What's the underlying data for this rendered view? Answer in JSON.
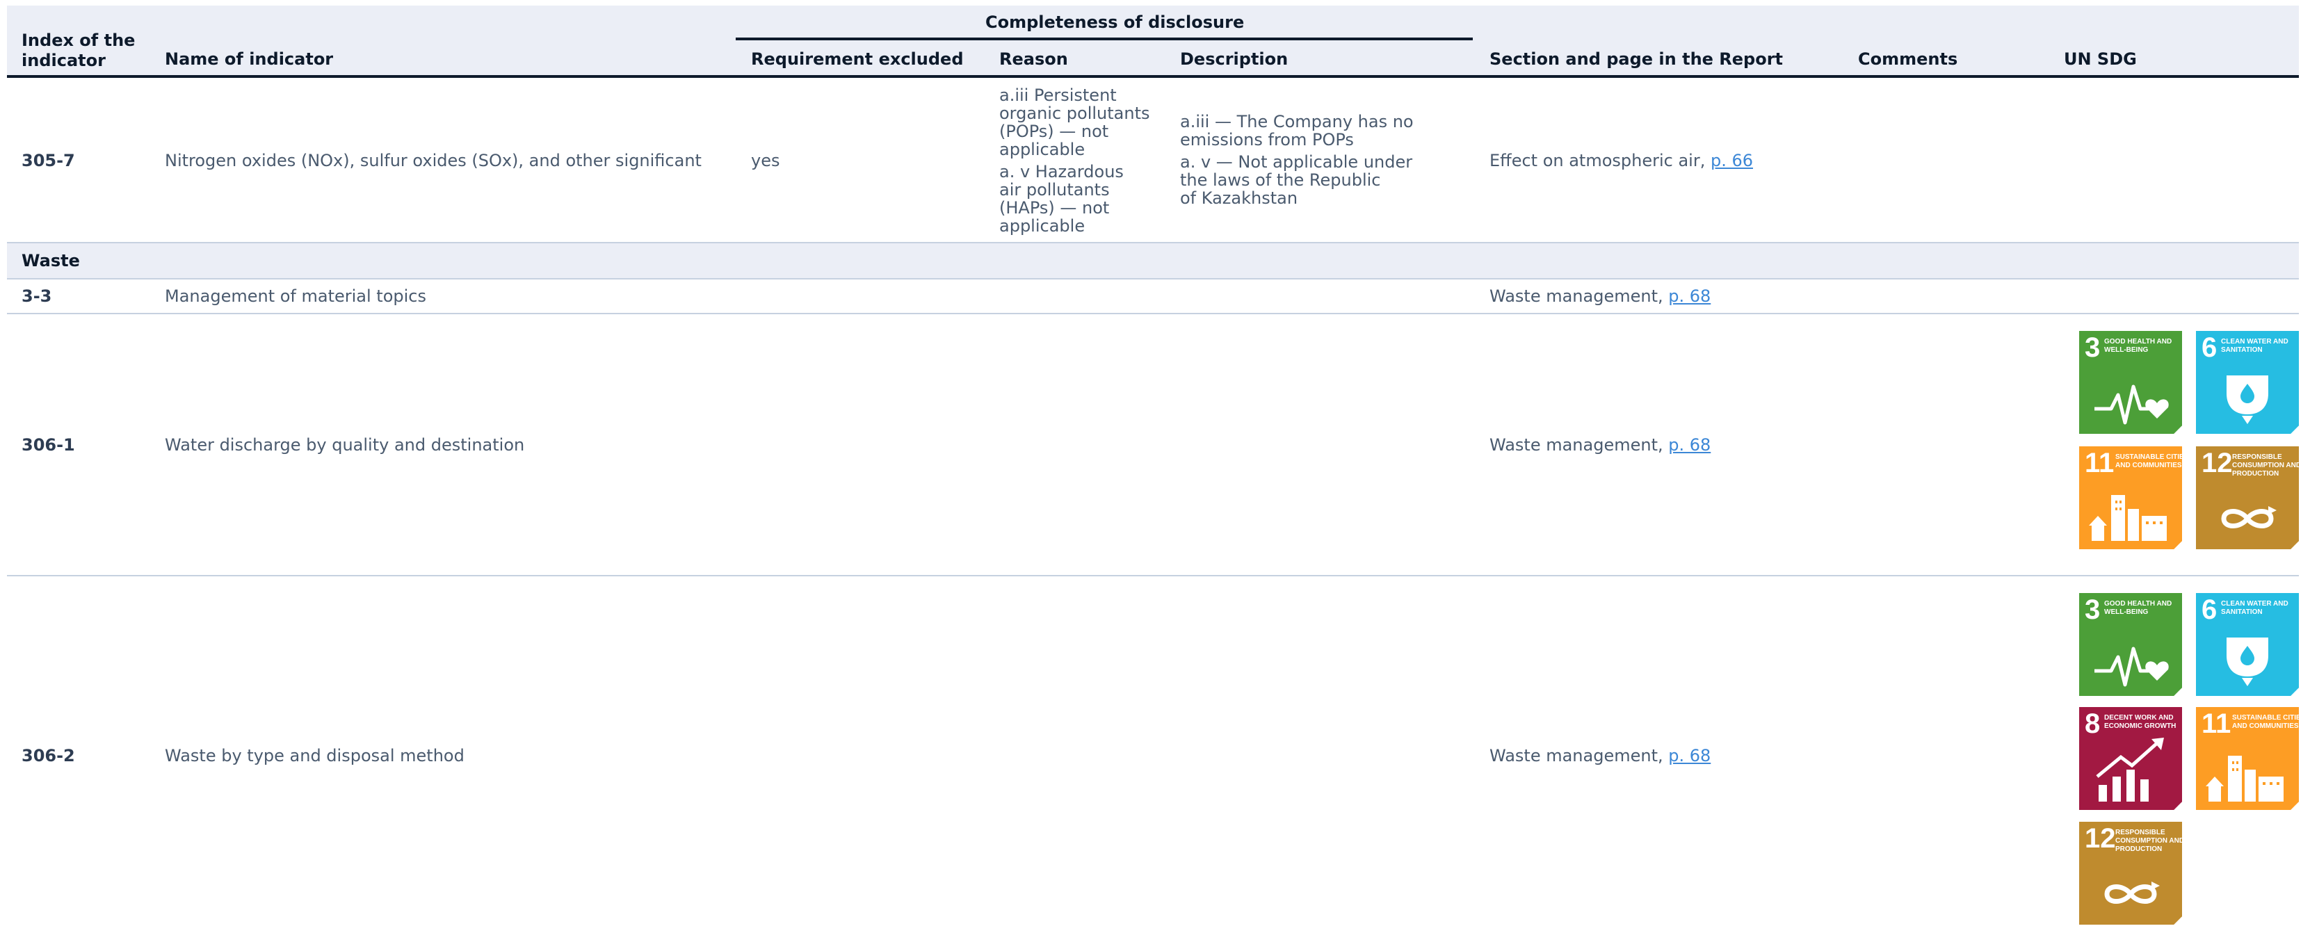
{
  "header": {
    "index": [
      "Index of the",
      "indicator"
    ],
    "name": "Name of indicator",
    "completeness": "Completeness of disclosure",
    "requirement": "Requirement excluded",
    "reason": "Reason",
    "description": "Description",
    "section": "Section and page in the Report",
    "comments": "Comments",
    "sdg": "UN SDG"
  },
  "rows": [
    {
      "index": "305-7",
      "name": "Nitrogen oxides (NOx), sulfur oxides (SOx), and other significant",
      "requirement": "yes",
      "reason": [
        "a.iii Persistent",
        "organic pollutants",
        "(POPs) — not",
        "applicable",
        "a. v Hazardous",
        "air pollutants",
        "(HAPs) — not",
        "applicable"
      ],
      "description": [
        "a.iii — The Company has no",
        "emissions from POPs",
        "a. v — Not applicable under",
        "the laws of the Republic",
        "of Kazakhstan"
      ],
      "section_text": "Effect on atmospheric air, ",
      "section_link": "p. 66"
    },
    {
      "section_title": "Waste"
    },
    {
      "index": "3-3",
      "name": "Management of material topics",
      "section_text": "Waste management, ",
      "section_link": "p. 68"
    },
    {
      "index": "306-1",
      "name": "Water discharge by quality and destination",
      "section_text": "Waste management, ",
      "section_link": "p. 68",
      "sdgs": [
        "sdg3",
        "sdg6",
        "sdg11",
        "sdg12"
      ]
    },
    {
      "index": "306-2",
      "name": "Waste by type and disposal method",
      "section_text": "Waste management, ",
      "section_link": "p. 68",
      "sdgs": [
        "sdg3",
        "sdg6",
        "sdg8",
        "sdg11",
        "sdg12"
      ]
    }
  ],
  "sdg_tiles": {
    "sdg3": {
      "number": "3",
      "label": "Good health and well-being",
      "color": "#4c9f38",
      "icon": "heartbeat-icon"
    },
    "sdg6": {
      "number": "6",
      "label": "Clean water and sanitation",
      "color": "#26bde2",
      "icon": "water-drop-icon"
    },
    "sdg8": {
      "number": "8",
      "label": "Decent work and economic growth",
      "color": "#a21942",
      "icon": "growth-chart-icon"
    },
    "sdg11": {
      "number": "11",
      "label": "Sustainable cities and communities",
      "color": "#fd9d24",
      "icon": "city-icon"
    },
    "sdg12": {
      "number": "12",
      "label": "Responsible consumption and production",
      "color": "#bf8b2e",
      "icon": "infinity-icon"
    }
  }
}
